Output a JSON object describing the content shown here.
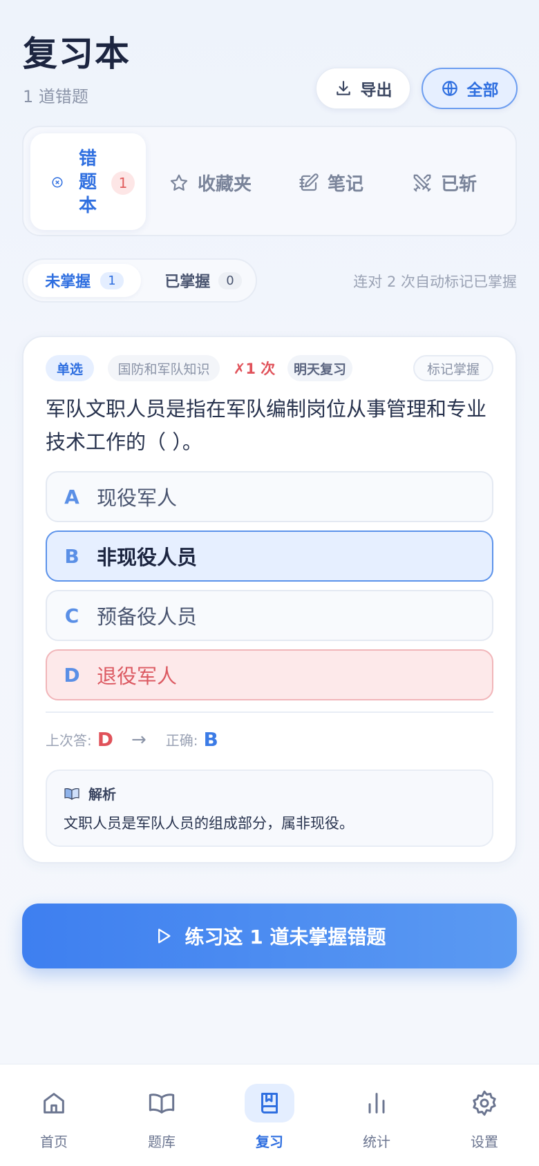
{
  "header": {
    "title": "复习本",
    "subtitle": "1 道错题",
    "export_label": "导出",
    "all_label": "全部"
  },
  "segments": {
    "active": {
      "label": "错题本",
      "count": "1"
    },
    "favorites": "收藏夹",
    "notes": "笔记",
    "eliminated": "已斩"
  },
  "mastery": {
    "unmastered_label": "未掌握",
    "unmastered_count": "1",
    "mastered_label": "已掌握",
    "mastered_count": "0",
    "hint": "连对 2 次自动标记已掌握"
  },
  "card": {
    "type": "单选",
    "category": "国防和军队知识",
    "wrong_count": "✗1 次",
    "review": "明天复习",
    "mark_label": "标记掌握",
    "question": "军队文职人员是指在军队编制岗位从事管理和专业技术工作的（ ）。",
    "options": [
      {
        "letter": "A",
        "text": "现役军人",
        "state": "normal"
      },
      {
        "letter": "B",
        "text": "非现役人员",
        "state": "correct"
      },
      {
        "letter": "C",
        "text": "预备役人员",
        "state": "normal"
      },
      {
        "letter": "D",
        "text": "退役军人",
        "state": "wrong"
      }
    ],
    "last_answer_label": "上次答:",
    "last_answer": "D",
    "arrow": "→",
    "correct_label": "正确:",
    "correct_answer": "B",
    "explanation_title": "解析",
    "explanation": "文职人员是军队人员的组成部分，属非现役。"
  },
  "practice_label": "练习这 1 道未掌握错题",
  "nav": [
    {
      "label": "首页",
      "icon": "home-icon"
    },
    {
      "label": "题库",
      "icon": "book-open-icon"
    },
    {
      "label": "复习",
      "icon": "bookmark-book-icon",
      "active": true
    },
    {
      "label": "统计",
      "icon": "bar-chart-icon"
    },
    {
      "label": "设置",
      "icon": "gear-icon"
    }
  ],
  "colors": {
    "accent": "#2f6fe0",
    "wrong": "#e0525a",
    "correct_bg": "#e6efff",
    "wrong_bg": "#fde9ea"
  }
}
